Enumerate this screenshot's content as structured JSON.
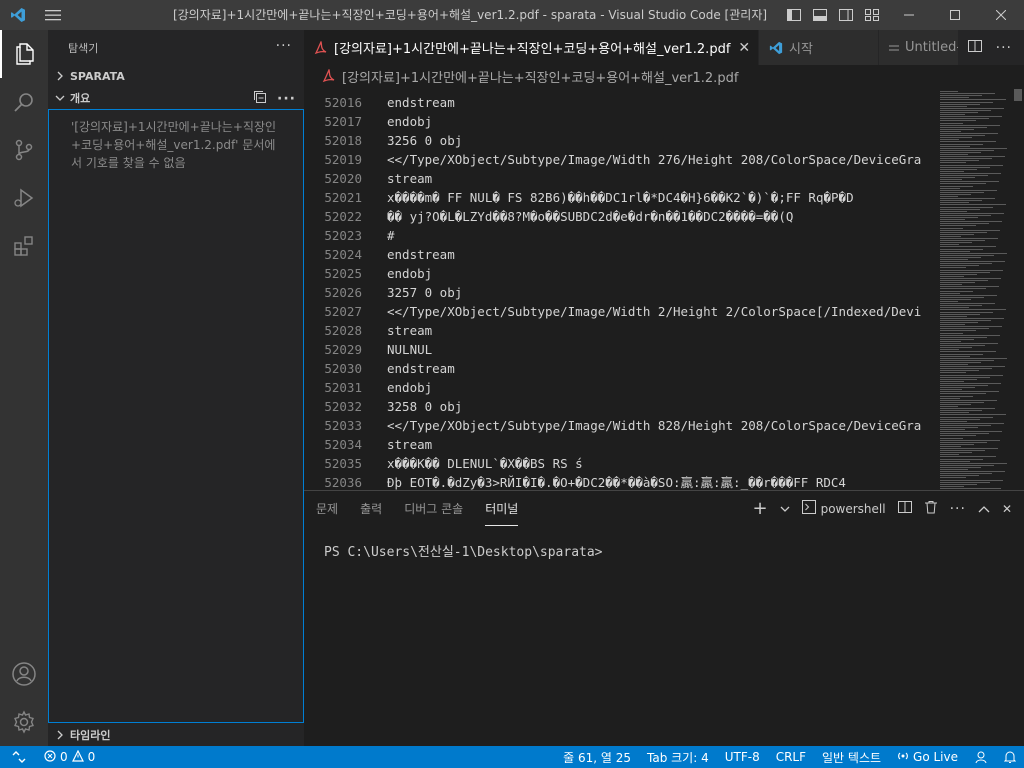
{
  "window": {
    "title": "[강의자료]+1시간만에+끝나는+직장인+코딩+용어+해설_ver1.2.pdf - sparata - Visual Studio Code [관리자]"
  },
  "sidebar": {
    "header": "탐색기",
    "folder": "SPARATA",
    "outline": {
      "title": "개요",
      "message": "'[강의자료]+1시간만에+끝나는+직장인+코딩+용어+해설_ver1.2.pdf' 문서에서 기호를 찾을 수 없음"
    },
    "timeline": "타임라인"
  },
  "tabs": [
    {
      "label": "[강의자료]+1시간만에+끝나는+직장인+코딩+용어+해설_ver1.2.pdf",
      "active": true,
      "icon": "pdf-icon"
    },
    {
      "label": "시작",
      "active": false,
      "icon": "vscode-icon"
    },
    {
      "label": "Untitled-",
      "active": false,
      "icon": "file-icon"
    }
  ],
  "breadcrumb": {
    "file": "[강의자료]+1시간만에+끝나는+직장인+코딩+용어+해설_ver1.2.pdf"
  },
  "editor": {
    "lines": [
      {
        "n": "52016",
        "t": "endstream"
      },
      {
        "n": "52017",
        "t": "endobj"
      },
      {
        "n": "52018",
        "t": "3256 0 obj"
      },
      {
        "n": "52019",
        "t": "<</Type/XObject/Subtype/Image/Width 276/Height 208/ColorSpace/DeviceGra"
      },
      {
        "n": "52020",
        "t": "stream"
      },
      {
        "n": "52021",
        "t": "x����m� FF NUL� FS 82B6)��h��DC1rl�*DC4�H}6��K2̀ �)`�;FF Rq�P�D"
      },
      {
        "n": "52022",
        "t": "��  yj?O�L�LZYd��8?M�o��SUBDC2d�e�dr�n��1��DC2����=��(Q"
      },
      {
        "n": "52023",
        "t": "#"
      },
      {
        "n": "52024",
        "t": "endstream"
      },
      {
        "n": "52025",
        "t": "endobj"
      },
      {
        "n": "52026",
        "t": "3257 0 obj"
      },
      {
        "n": "52027",
        "t": "<</Type/XObject/Subtype/Image/Width 2/Height 2/ColorSpace[/Indexed/Devi"
      },
      {
        "n": "52028",
        "t": "stream"
      },
      {
        "n": "52029",
        "t": "NULNUL"
      },
      {
        "n": "52030",
        "t": "endstream"
      },
      {
        "n": "52031",
        "t": "endobj"
      },
      {
        "n": "52032",
        "t": "3258 0 obj"
      },
      {
        "n": "52033",
        "t": "<</Type/XObject/Subtype/Image/Width 828/Height 208/ColorSpace/DeviceGra"
      },
      {
        "n": "52034",
        "t": "stream"
      },
      {
        "n": "52035",
        "t": "x���K�� DLENUL`�X��BS RS ś"
      },
      {
        "n": "52036",
        "t": "Ðþ EOT�.�dZy�3>RЙI�I�.�O+�DC2��*��à�SO:贏:贏:贏:_��r���FF RDC4"
      }
    ]
  },
  "panel": {
    "tabs": [
      "문제",
      "출력",
      "디버그 콘솔",
      "터미널"
    ],
    "active_tab": "터미널",
    "shell": "powershell",
    "prompt": "PS C:\\Users\\전산실-1\\Desktop\\sparata>"
  },
  "statusbar": {
    "errors": "0",
    "warnings": "0",
    "position": "줄 61, 열 25",
    "tab_size": "Tab 크기: 4",
    "encoding": "UTF-8",
    "eol": "CRLF",
    "language": "일반 텍스트",
    "golive": "Go Live"
  },
  "colors": {
    "accent": "#007acc",
    "activity_bar": "#333333",
    "sidebar": "#252526",
    "editor": "#1e1e1e",
    "titlebar": "#3c3c3c",
    "control_char": "#8b0000"
  }
}
